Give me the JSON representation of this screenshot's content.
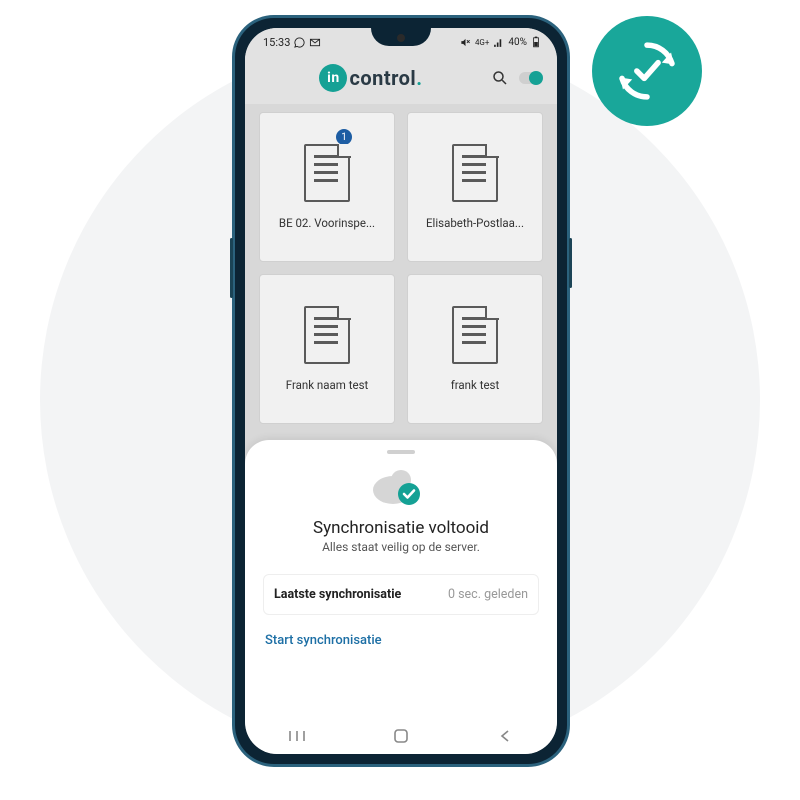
{
  "statusbar": {
    "time": "15:33",
    "battery": "40%",
    "signal": "4G+"
  },
  "app": {
    "logo_badge": "in",
    "logo_text": "control",
    "logo_dot": "."
  },
  "cards": [
    {
      "label": "BE 02. Voorinspe...",
      "badge": "1"
    },
    {
      "label": "Elisabeth-Postlaa..."
    },
    {
      "label": "Frank naam test"
    },
    {
      "label": "frank test"
    }
  ],
  "sheet": {
    "title": "Synchronisatie voltooid",
    "subtitle": "Alles staat veilig op de server.",
    "last_label": "Laatste synchronisatie",
    "last_value": "0 sec. geleden",
    "start": "Start synchronisatie"
  }
}
